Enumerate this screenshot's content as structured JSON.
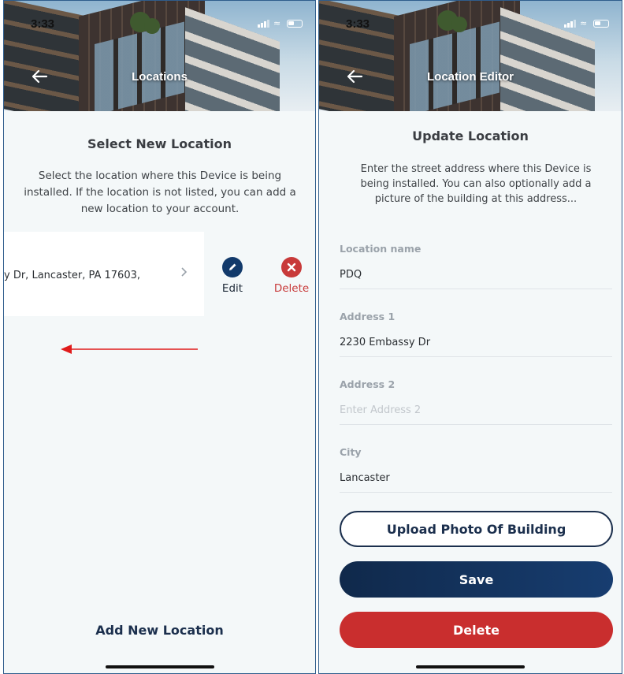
{
  "left_screen": {
    "status_time": "3:33",
    "header_title": "Locations",
    "section_title": "Select New Location",
    "description": "Select the location where this Device is being installed. If the location is not listed, you can add a new location to your account.",
    "location_row_text": "y Dr, Lancaster, PA 17603,",
    "edit_label": "Edit",
    "delete_label": "Delete",
    "add_new_location_label": "Add New Location"
  },
  "right_screen": {
    "status_time": "3:33",
    "header_title": "Location Editor",
    "section_title": "Update Location",
    "description": "Enter the street address where this Device is being installed. You can also optionally add a picture of the building at this address...",
    "fields": [
      {
        "label": "Location name",
        "value": "PDQ",
        "placeholder": ""
      },
      {
        "label": "Address 1",
        "value": "2230 Embassy Dr",
        "placeholder": ""
      },
      {
        "label": "Address 2",
        "value": "",
        "placeholder": "Enter Address 2"
      },
      {
        "label": "City",
        "value": "Lancaster",
        "placeholder": ""
      }
    ],
    "upload_button_label": "Upload Photo Of Building",
    "save_button_label": "Save",
    "delete_button_label": "Delete"
  },
  "colors": {
    "navy": "#1b2f4d",
    "edit_icon": "#123a6b",
    "delete_red": "#c92e2e",
    "annotation_arrow": "#e01b1b"
  },
  "icons": [
    "back-arrow-icon",
    "chevron-right-icon",
    "pencil-icon",
    "close-icon",
    "signal-icon",
    "wifi-icon",
    "battery-icon"
  ]
}
